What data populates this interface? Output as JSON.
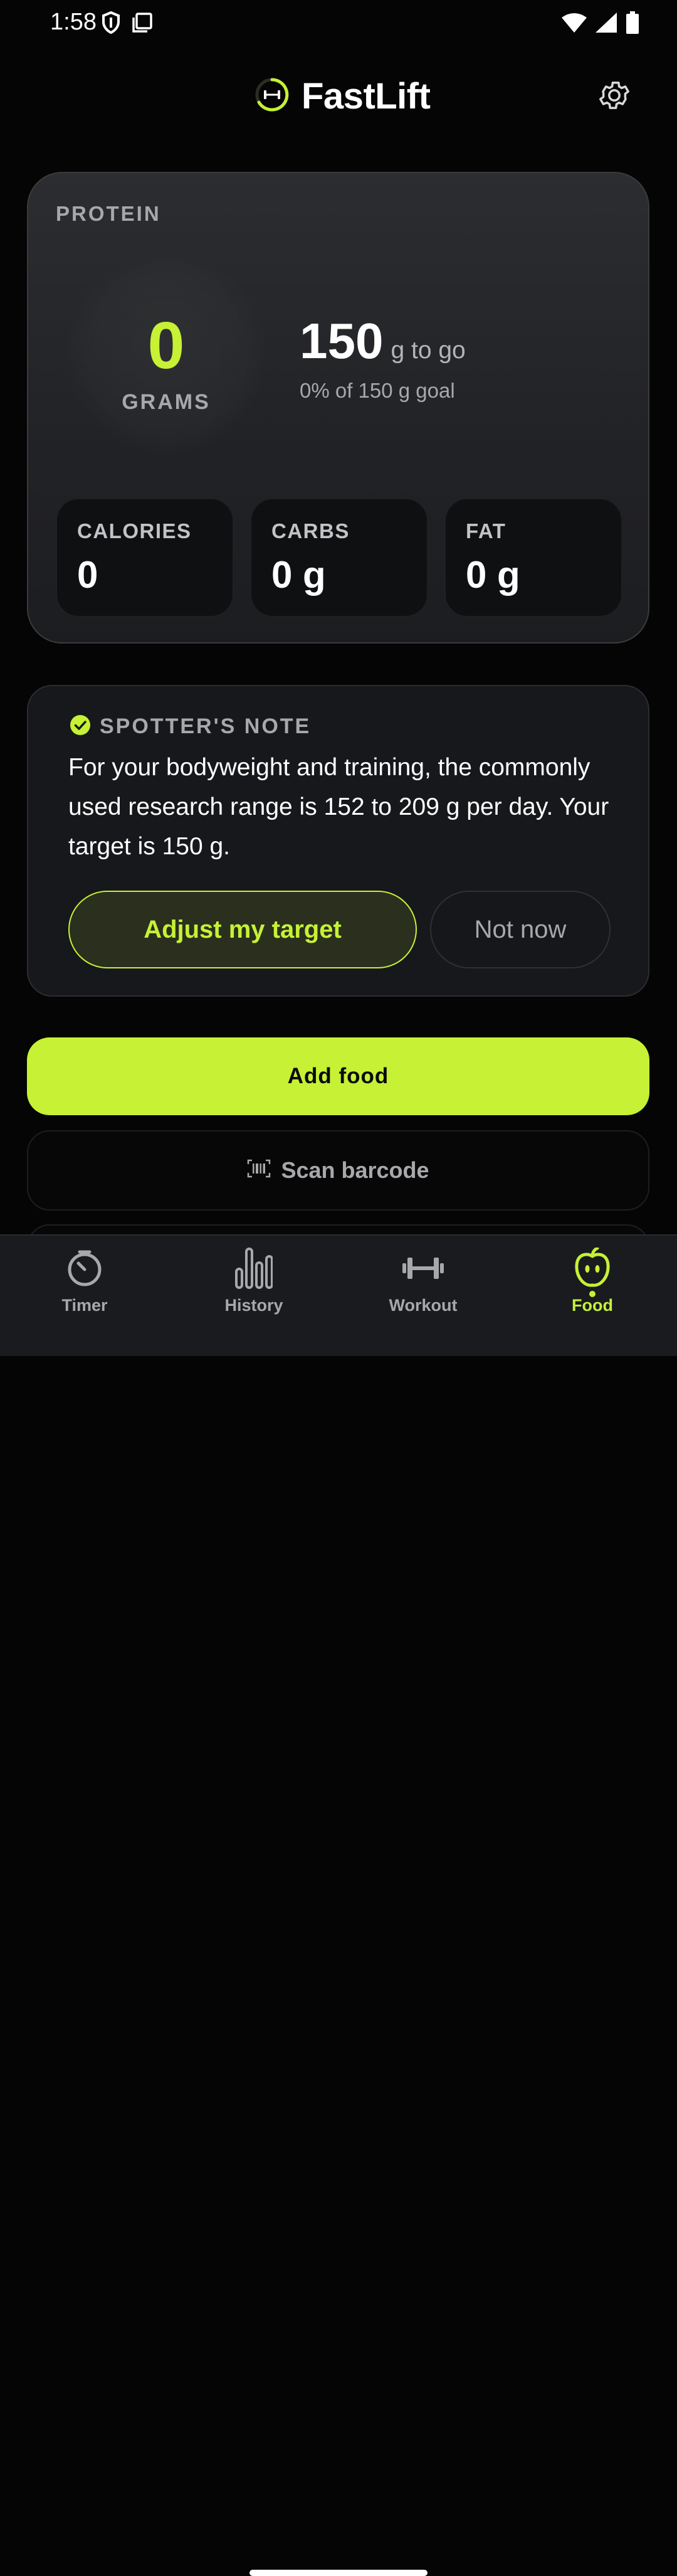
{
  "status_bar": {
    "time": "1:58",
    "icons": [
      "shield-icon",
      "screenshot-icon",
      "wifi-icon",
      "signal-icon",
      "battery-icon"
    ]
  },
  "header": {
    "app_name": "FastLift",
    "logo_icon": "dumbbell-ring-logo",
    "settings_icon": "gear-icon"
  },
  "protein_card": {
    "label": "PROTEIN",
    "grams_value": "0",
    "grams_unit": "GRAMS",
    "remaining_value": "150",
    "remaining_unit": "g to go",
    "goal_text": "0% of 150 g goal",
    "progress_fraction": 0,
    "macros": [
      {
        "label": "CALORIES",
        "value": "0"
      },
      {
        "label": "CARBS",
        "value": "0 g"
      },
      {
        "label": "FAT",
        "value": "0 g"
      }
    ]
  },
  "spotter_note": {
    "title": "SPOTTER'S NOTE",
    "icon": "check-circle-icon",
    "body": "For your bodyweight and training, the commonly used research range is 152 to 209 g per day. Your target is 150 g.",
    "primary_button": "Adjust my target",
    "secondary_button": "Not now"
  },
  "actions": {
    "add_food": "Add food",
    "scan_barcode": "Scan barcode",
    "scan_icon": "barcode-icon"
  },
  "bottom_nav": {
    "items": [
      {
        "label": "Timer",
        "icon": "stopwatch-icon",
        "active": false
      },
      {
        "label": "History",
        "icon": "bar-chart-icon",
        "active": false
      },
      {
        "label": "Workout",
        "icon": "dumbbell-icon",
        "active": false
      },
      {
        "label": "Food",
        "icon": "apple-icon",
        "active": true
      }
    ]
  },
  "colors": {
    "accent": "#c6f135",
    "background": "#050505",
    "card": "#222326",
    "muted_text": "#a7a8ab"
  }
}
